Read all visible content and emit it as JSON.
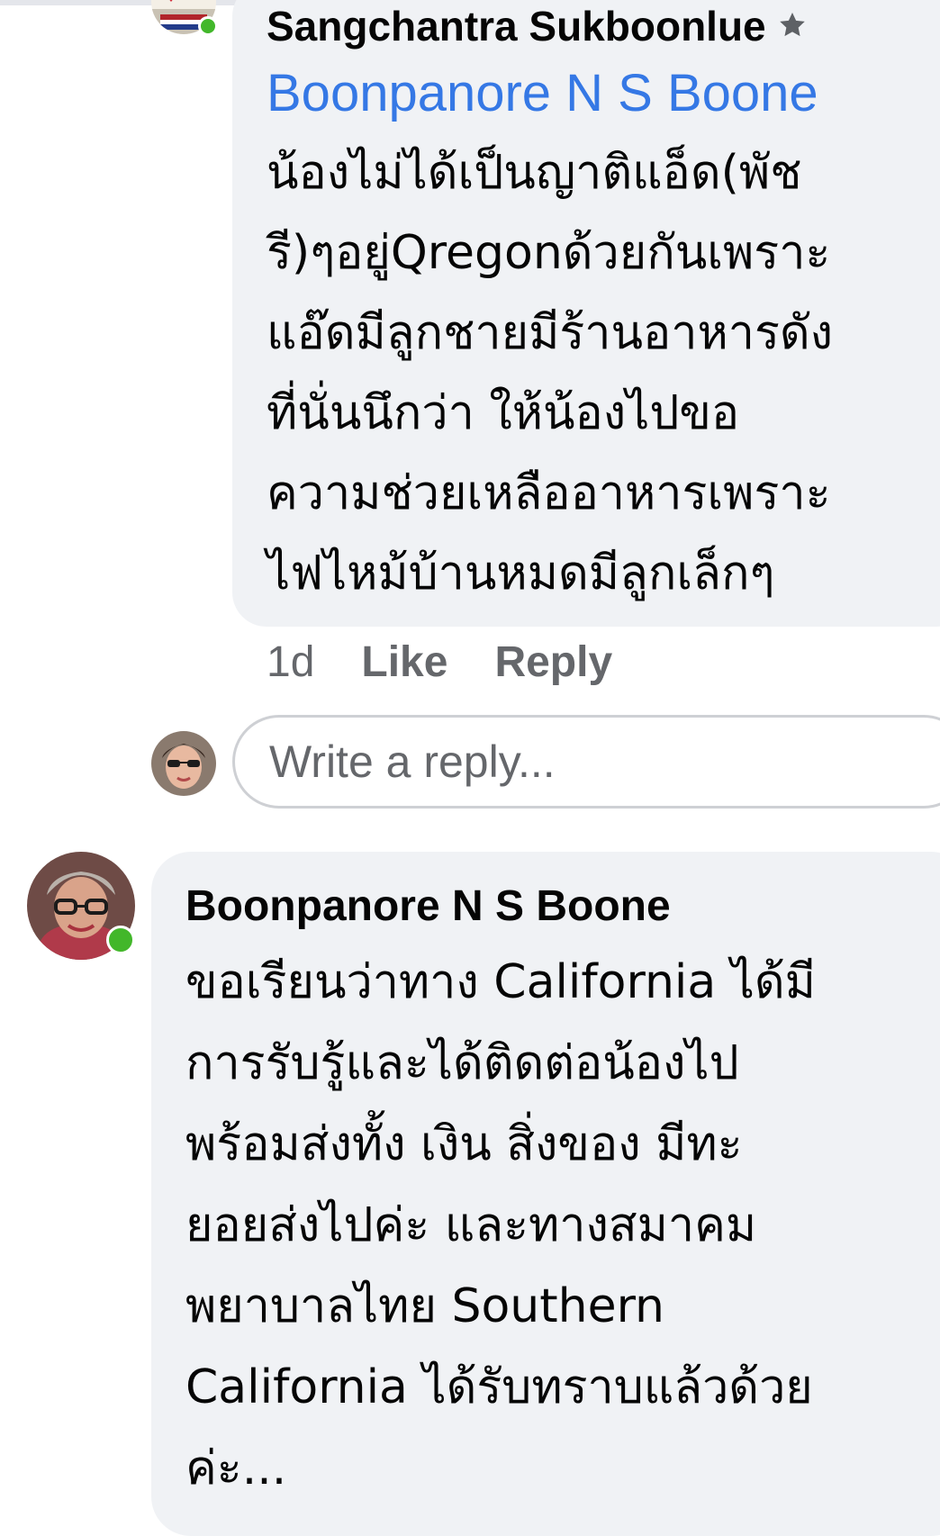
{
  "reply_comment": {
    "author": "Sangchantra Sukboonlue",
    "author_badge_icon": "top-fan-star-icon",
    "mention": "Boonpanore N S Boone",
    "text_lines": [
      "น้องไม่ได้เป็นญาติแอ็ด(พัช",
      "รี)ๆอยู่Qregonด้วยกันเพราะ",
      "แอ๊ดมีลูกชายมีร้านอาหารดัง",
      "ที่นั่นนึกว่า ให้น้องไปขอ",
      "ความช่วยเหลืออาหารเพราะ",
      "ไฟไหม้บ้านหมดมีลูกเล็กๆ"
    ],
    "timestamp": "1d",
    "like_label": "Like",
    "reply_label": "Reply"
  },
  "reply_box": {
    "placeholder": "Write a reply..."
  },
  "main_comment": {
    "author": "Boonpanore N S Boone",
    "text_lines": [
      "ขอเรียนว่าทาง California ได้มี",
      "การรับรู้และได้ติดต่อน้องไป",
      "พร้อมส่งทั้ง เงิน สิ่งของ มีทะ",
      "ยอยส่งไปค่ะ และทางสมาคม",
      "พยาบาลไทย Southern",
      "California ได้รับทราบแล้วด้วย",
      "ค่ะ..."
    ]
  },
  "colors": {
    "bubble_bg": "#f0f2f5",
    "mention_link": "#3578e5",
    "meta_text": "#65676b",
    "online_green": "#42b72a",
    "input_border": "#ced0d4"
  }
}
